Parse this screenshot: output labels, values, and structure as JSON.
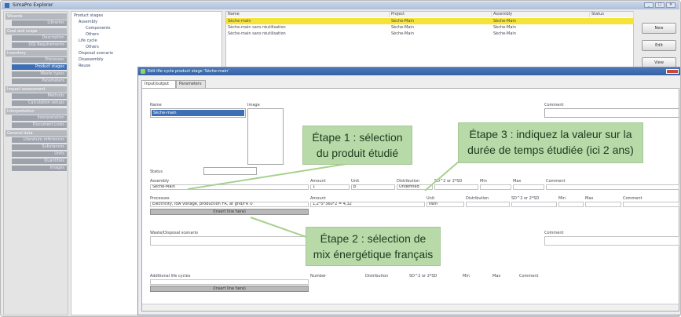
{
  "window": {
    "title": "SimaPro Explorer"
  },
  "nav": {
    "headers": [
      "Wizards",
      "Goal and scope",
      "Inventory",
      "Impact assessment",
      "Interpretation",
      "General data"
    ],
    "items": [
      "Libraries",
      "Description",
      "DQI Requirements",
      "Processes",
      "Product stages",
      "Waste types",
      "Parameters",
      "Methods",
      "Calculation setups",
      "Interpretation",
      "Document Links",
      "Literature references",
      "Substances",
      "Units",
      "Quantities",
      "Images"
    ]
  },
  "tree": {
    "items": [
      "Product stages",
      "Assembly",
      "Components",
      "Others",
      "Life cycle",
      "Others",
      "Disposal scenario",
      "Disassembly",
      "Reuse"
    ]
  },
  "top_table": {
    "headers": [
      "Name",
      "Project",
      "Assembly",
      "Status"
    ],
    "rows": [
      [
        "Sèche-main",
        "Sèche-Main",
        "Sèche-Main",
        ""
      ],
      [
        "Sèche-main sans réutilisation",
        "Sèche-Main",
        "Sèche-Main",
        ""
      ],
      [
        "Sèche-main sans réutilisation",
        "Sèche-Main",
        "Sèche-Main",
        ""
      ]
    ]
  },
  "right_buttons": {
    "new": "New",
    "edit": "Edit",
    "view": "View"
  },
  "dialog": {
    "title": "Edit life cycle product stage 'Sèche-main'",
    "tabs": [
      "Input/output",
      "Parameters"
    ],
    "name_label": "Name",
    "name_value": "Sèche-main",
    "image_label": "Image",
    "comment_label": "Comment",
    "status_label": "Status",
    "assembly_headers": [
      "Assembly",
      "Amount",
      "Unit",
      "Distribution",
      "SD^2 or 2*SD",
      "Min",
      "Max",
      "Comment"
    ],
    "assembly_row": [
      "Sèche-Main",
      "1",
      "p",
      "Undefined"
    ],
    "processes_headers": [
      "Processes",
      "Amount",
      "Unit",
      "Distribution",
      "SD^2 or 2*SD",
      "Min",
      "Max",
      "Comment"
    ],
    "processes_row": [
      "Electricity, low voltage, production FR, at grid/FR U",
      "1,2*5*360*2 = 4,32",
      "kWh"
    ],
    "insert_line_label": "(Insert line here)",
    "waste_label": "Waste/Disposal scenario",
    "additional_label": "Additional life cycles",
    "additional_headers": [
      "Number",
      "Distribution",
      "SD^2 or 2*SD",
      "Min",
      "Max",
      "Comment"
    ]
  },
  "callouts": {
    "step1": [
      "Étape 1 : sélection",
      "du produit étudié"
    ],
    "step2": [
      "Étape 2 : sélection de",
      "mix énergétique français"
    ],
    "step3": [
      "Étape 3 : indiquez la valeur sur la",
      "durée de temps étudiée (ici 2 ans)"
    ]
  }
}
